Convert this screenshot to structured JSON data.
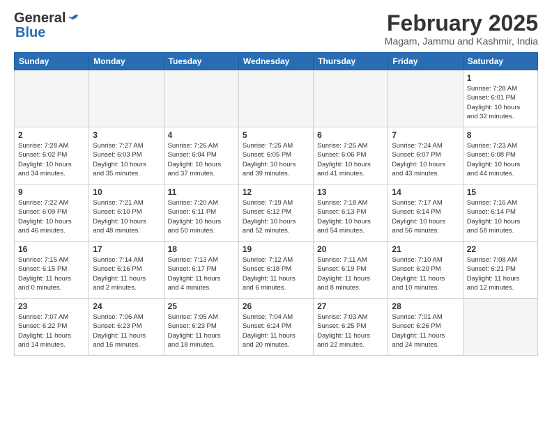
{
  "header": {
    "logo_general": "General",
    "logo_blue": "Blue",
    "month_title": "February 2025",
    "location": "Magam, Jammu and Kashmir, India"
  },
  "days_of_week": [
    "Sunday",
    "Monday",
    "Tuesday",
    "Wednesday",
    "Thursday",
    "Friday",
    "Saturday"
  ],
  "weeks": [
    [
      {
        "day": "",
        "info": ""
      },
      {
        "day": "",
        "info": ""
      },
      {
        "day": "",
        "info": ""
      },
      {
        "day": "",
        "info": ""
      },
      {
        "day": "",
        "info": ""
      },
      {
        "day": "",
        "info": ""
      },
      {
        "day": "1",
        "info": "Sunrise: 7:28 AM\nSunset: 6:01 PM\nDaylight: 10 hours\nand 32 minutes."
      }
    ],
    [
      {
        "day": "2",
        "info": "Sunrise: 7:28 AM\nSunset: 6:02 PM\nDaylight: 10 hours\nand 34 minutes."
      },
      {
        "day": "3",
        "info": "Sunrise: 7:27 AM\nSunset: 6:03 PM\nDaylight: 10 hours\nand 35 minutes."
      },
      {
        "day": "4",
        "info": "Sunrise: 7:26 AM\nSunset: 6:04 PM\nDaylight: 10 hours\nand 37 minutes."
      },
      {
        "day": "5",
        "info": "Sunrise: 7:25 AM\nSunset: 6:05 PM\nDaylight: 10 hours\nand 39 minutes."
      },
      {
        "day": "6",
        "info": "Sunrise: 7:25 AM\nSunset: 6:06 PM\nDaylight: 10 hours\nand 41 minutes."
      },
      {
        "day": "7",
        "info": "Sunrise: 7:24 AM\nSunset: 6:07 PM\nDaylight: 10 hours\nand 43 minutes."
      },
      {
        "day": "8",
        "info": "Sunrise: 7:23 AM\nSunset: 6:08 PM\nDaylight: 10 hours\nand 44 minutes."
      }
    ],
    [
      {
        "day": "9",
        "info": "Sunrise: 7:22 AM\nSunset: 6:09 PM\nDaylight: 10 hours\nand 46 minutes."
      },
      {
        "day": "10",
        "info": "Sunrise: 7:21 AM\nSunset: 6:10 PM\nDaylight: 10 hours\nand 48 minutes."
      },
      {
        "day": "11",
        "info": "Sunrise: 7:20 AM\nSunset: 6:11 PM\nDaylight: 10 hours\nand 50 minutes."
      },
      {
        "day": "12",
        "info": "Sunrise: 7:19 AM\nSunset: 6:12 PM\nDaylight: 10 hours\nand 52 minutes."
      },
      {
        "day": "13",
        "info": "Sunrise: 7:18 AM\nSunset: 6:13 PM\nDaylight: 10 hours\nand 54 minutes."
      },
      {
        "day": "14",
        "info": "Sunrise: 7:17 AM\nSunset: 6:14 PM\nDaylight: 10 hours\nand 56 minutes."
      },
      {
        "day": "15",
        "info": "Sunrise: 7:16 AM\nSunset: 6:14 PM\nDaylight: 10 hours\nand 58 minutes."
      }
    ],
    [
      {
        "day": "16",
        "info": "Sunrise: 7:15 AM\nSunset: 6:15 PM\nDaylight: 11 hours\nand 0 minutes."
      },
      {
        "day": "17",
        "info": "Sunrise: 7:14 AM\nSunset: 6:16 PM\nDaylight: 11 hours\nand 2 minutes."
      },
      {
        "day": "18",
        "info": "Sunrise: 7:13 AM\nSunset: 6:17 PM\nDaylight: 11 hours\nand 4 minutes."
      },
      {
        "day": "19",
        "info": "Sunrise: 7:12 AM\nSunset: 6:18 PM\nDaylight: 11 hours\nand 6 minutes."
      },
      {
        "day": "20",
        "info": "Sunrise: 7:11 AM\nSunset: 6:19 PM\nDaylight: 11 hours\nand 8 minutes."
      },
      {
        "day": "21",
        "info": "Sunrise: 7:10 AM\nSunset: 6:20 PM\nDaylight: 11 hours\nand 10 minutes."
      },
      {
        "day": "22",
        "info": "Sunrise: 7:08 AM\nSunset: 6:21 PM\nDaylight: 11 hours\nand 12 minutes."
      }
    ],
    [
      {
        "day": "23",
        "info": "Sunrise: 7:07 AM\nSunset: 6:22 PM\nDaylight: 11 hours\nand 14 minutes."
      },
      {
        "day": "24",
        "info": "Sunrise: 7:06 AM\nSunset: 6:23 PM\nDaylight: 11 hours\nand 16 minutes."
      },
      {
        "day": "25",
        "info": "Sunrise: 7:05 AM\nSunset: 6:23 PM\nDaylight: 11 hours\nand 18 minutes."
      },
      {
        "day": "26",
        "info": "Sunrise: 7:04 AM\nSunset: 6:24 PM\nDaylight: 11 hours\nand 20 minutes."
      },
      {
        "day": "27",
        "info": "Sunrise: 7:03 AM\nSunset: 6:25 PM\nDaylight: 11 hours\nand 22 minutes."
      },
      {
        "day": "28",
        "info": "Sunrise: 7:01 AM\nSunset: 6:26 PM\nDaylight: 11 hours\nand 24 minutes."
      },
      {
        "day": "",
        "info": ""
      }
    ]
  ]
}
